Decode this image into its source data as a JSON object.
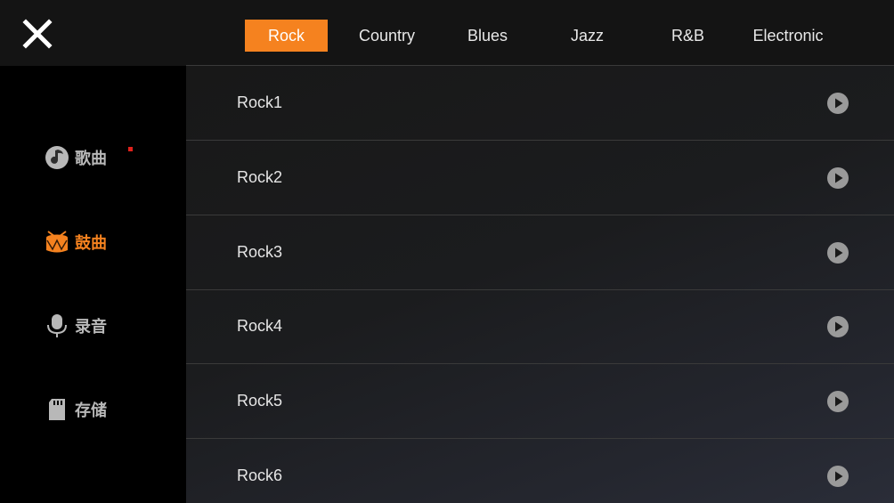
{
  "tabs": [
    "Rock",
    "Country",
    "Blues",
    "Jazz",
    "R&B",
    "Electronic"
  ],
  "active_tab": "Rock",
  "sidebar": {
    "items": [
      {
        "label": "歌曲",
        "icon": "music-note-icon"
      },
      {
        "label": "鼓曲",
        "icon": "drum-icon"
      },
      {
        "label": "录音",
        "icon": "microphone-icon"
      },
      {
        "label": "存储",
        "icon": "sd-card-icon"
      }
    ],
    "active_index": 1
  },
  "songs": [
    "Rock1",
    "Rock2",
    "Rock3",
    "Rock4",
    "Rock5",
    "Rock6"
  ],
  "colors": {
    "accent": "#f5821f",
    "notification_dot": "#e0211b",
    "inactive_text": "#b8b8b8"
  }
}
